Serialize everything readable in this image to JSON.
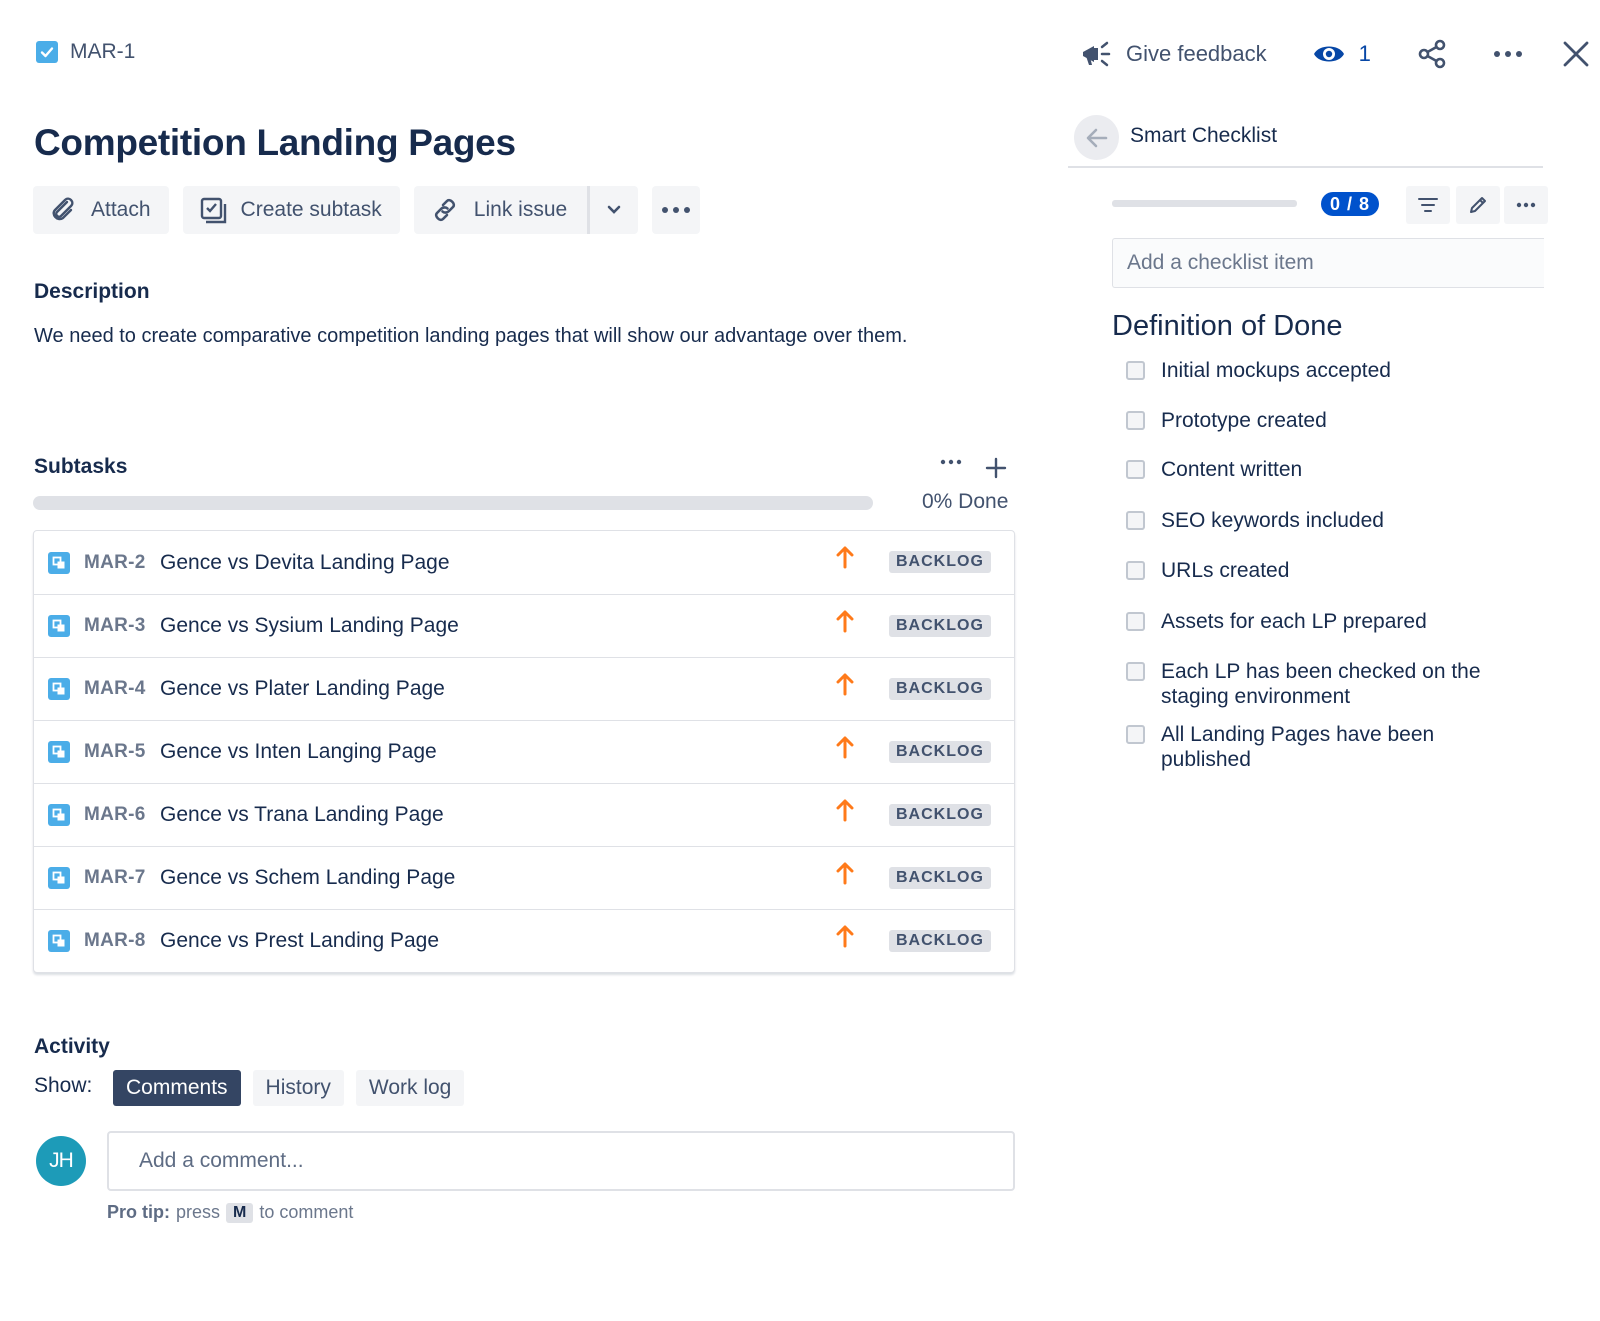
{
  "header": {
    "issue_key": "MAR-1",
    "give_feedback": "Give feedback",
    "watchers_count": "1"
  },
  "issue": {
    "title": "Competition Landing Pages"
  },
  "toolbar": {
    "attach": "Attach",
    "create_subtask": "Create subtask",
    "link_issue": "Link issue"
  },
  "description": {
    "heading": "Description",
    "text": "We need to create comparative competition landing pages that will show our advantage over them."
  },
  "subtasks": {
    "heading": "Subtasks",
    "progress_percent": 0,
    "done_label": "0% Done",
    "items": [
      {
        "key": "MAR-2",
        "name": "Gence vs Devita Landing Page",
        "status": "BACKLOG"
      },
      {
        "key": "MAR-3",
        "name": "Gence vs Sysium Landing Page",
        "status": "BACKLOG"
      },
      {
        "key": "MAR-4",
        "name": "Gence vs Plater Landing Page",
        "status": "BACKLOG"
      },
      {
        "key": "MAR-5",
        "name": "Gence vs Inten Langing Page",
        "status": "BACKLOG"
      },
      {
        "key": "MAR-6",
        "name": "Gence vs Trana Landing Page",
        "status": "BACKLOG"
      },
      {
        "key": "MAR-7",
        "name": "Gence vs Schem Landing Page",
        "status": "BACKLOG"
      },
      {
        "key": "MAR-8",
        "name": "Gence vs Prest Landing Page",
        "status": "BACKLOG"
      }
    ]
  },
  "activity": {
    "heading": "Activity",
    "show_label": "Show:",
    "tabs": [
      "Comments",
      "History",
      "Work log"
    ],
    "active_tab": "Comments",
    "avatar_initials": "JH",
    "comment_placeholder": "Add a comment...",
    "pro_tip_label": "Pro tip:",
    "pro_tip_press": "press",
    "pro_tip_key": "M",
    "pro_tip_suffix": "to comment"
  },
  "smart_checklist": {
    "title": "Smart Checklist",
    "count": "0 / 8",
    "progress_fraction": 0,
    "add_placeholder": "Add a checklist item",
    "section_title": "Definition of Done",
    "items": [
      "Initial mockups accepted",
      "Prototype created",
      "Content written",
      "SEO keywords included",
      "URLs created",
      "Assets for each LP prepared",
      "Each LP has been checked on the staging environment",
      "All Landing Pages have been published"
    ]
  },
  "colors": {
    "accent": "#0052cc",
    "priority_high": "#ff7a1a",
    "issue_icon": "#4bade8",
    "active_tab": "#344563"
  },
  "icons": {
    "issue_type": "checkbox-icon",
    "feedback": "megaphone-icon",
    "watch": "eye-icon",
    "share": "share-icon",
    "more": "more-icon",
    "close": "close-icon",
    "subtask": "subtask-icon",
    "priority": "arrow-up-icon"
  }
}
